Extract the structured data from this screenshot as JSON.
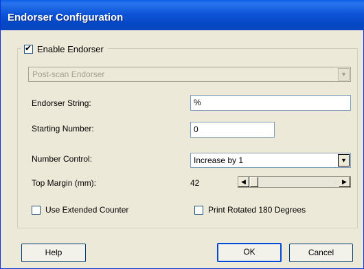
{
  "window": {
    "title": "Endorser Configuration"
  },
  "enable_endorser": {
    "label": "Enable Endorser",
    "checked": true
  },
  "endorser_type": {
    "value": "Post-scan Endorser",
    "disabled": true
  },
  "fields": {
    "endorser_string": {
      "label": "Endorser String:",
      "value": "%"
    },
    "starting_number": {
      "label": "Starting Number:",
      "value": "0"
    },
    "number_control": {
      "label": "Number Control:",
      "value": "Increase by 1"
    },
    "top_margin": {
      "label": "Top Margin (mm):",
      "value": "42"
    }
  },
  "options": {
    "use_extended_counter": {
      "label": "Use Extended Counter",
      "checked": false
    },
    "print_rotated": {
      "label": "Print Rotated 180 Degrees",
      "checked": false
    }
  },
  "buttons": {
    "help": "Help",
    "ok": "OK",
    "cancel": "Cancel"
  },
  "icons": {
    "dropdown": "chevron-down-icon",
    "scroll_left": "arrow-left-icon",
    "scroll_right": "arrow-right-icon",
    "check": "checkmark-icon"
  },
  "colors": {
    "titlebar": "#0a5fe6",
    "dialog_bg": "#ece9d8",
    "default_button_border": "#0048d8"
  }
}
